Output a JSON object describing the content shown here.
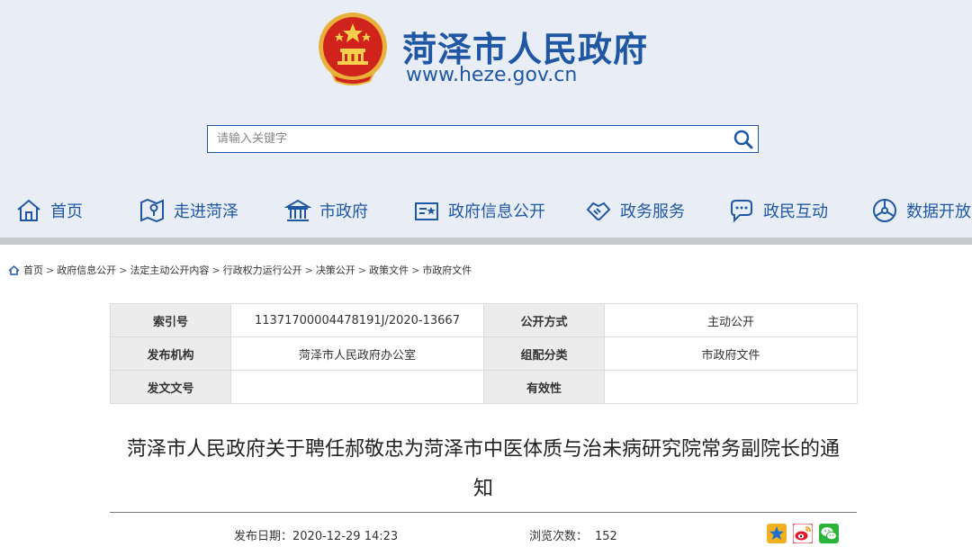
{
  "header": {
    "title": "菏泽市人民政府",
    "url": "www.heze.gov.cn"
  },
  "search": {
    "placeholder": "请输入关键字"
  },
  "nav": {
    "items": [
      {
        "label": "首页",
        "icon": "home-icon"
      },
      {
        "label": "走进菏泽",
        "icon": "map-icon"
      },
      {
        "label": "市政府",
        "icon": "government-building-icon"
      },
      {
        "label": "政府信息公开",
        "icon": "info-card-icon"
      },
      {
        "label": "政务服务",
        "icon": "handshake-icon"
      },
      {
        "label": "政民互动",
        "icon": "chat-icon"
      },
      {
        "label": "数据开放",
        "icon": "data-globe-icon"
      }
    ]
  },
  "breadcrumb": {
    "items": [
      "首页",
      "政府信息公开",
      "法定主动公开内容",
      "行政权力运行公开",
      "决策公开",
      "政策文件",
      "市政府文件"
    ],
    "separator": ">"
  },
  "meta": {
    "index_label": "索引号",
    "index_value": "11371700004478191J/2020-13667",
    "disclosure_label": "公开方式",
    "disclosure_value": "主动公开",
    "publisher_label": "发布机构",
    "publisher_value": "菏泽市人民政府办公室",
    "category_label": "组配分类",
    "category_value": "市政府文件",
    "docno_label": "发文文号",
    "docno_value": "",
    "validity_label": "有效性",
    "validity_value": ""
  },
  "article": {
    "title_line1": "菏泽市人民政府关于聘任郝敬忠为菏泽市中医体质与治未病研究院常务副院长的通",
    "title_line2": "知",
    "date_label": "发布日期：",
    "date_value": "2020-12-29 14:23",
    "views_label": "浏览次数：",
    "views_value": "152"
  },
  "share": [
    "qzone-icon",
    "weibo-icon",
    "wechat-icon"
  ],
  "colors": {
    "brand": "#1f57a4",
    "header_bg": "#e9eef6",
    "strip": "#c7c9cc"
  }
}
